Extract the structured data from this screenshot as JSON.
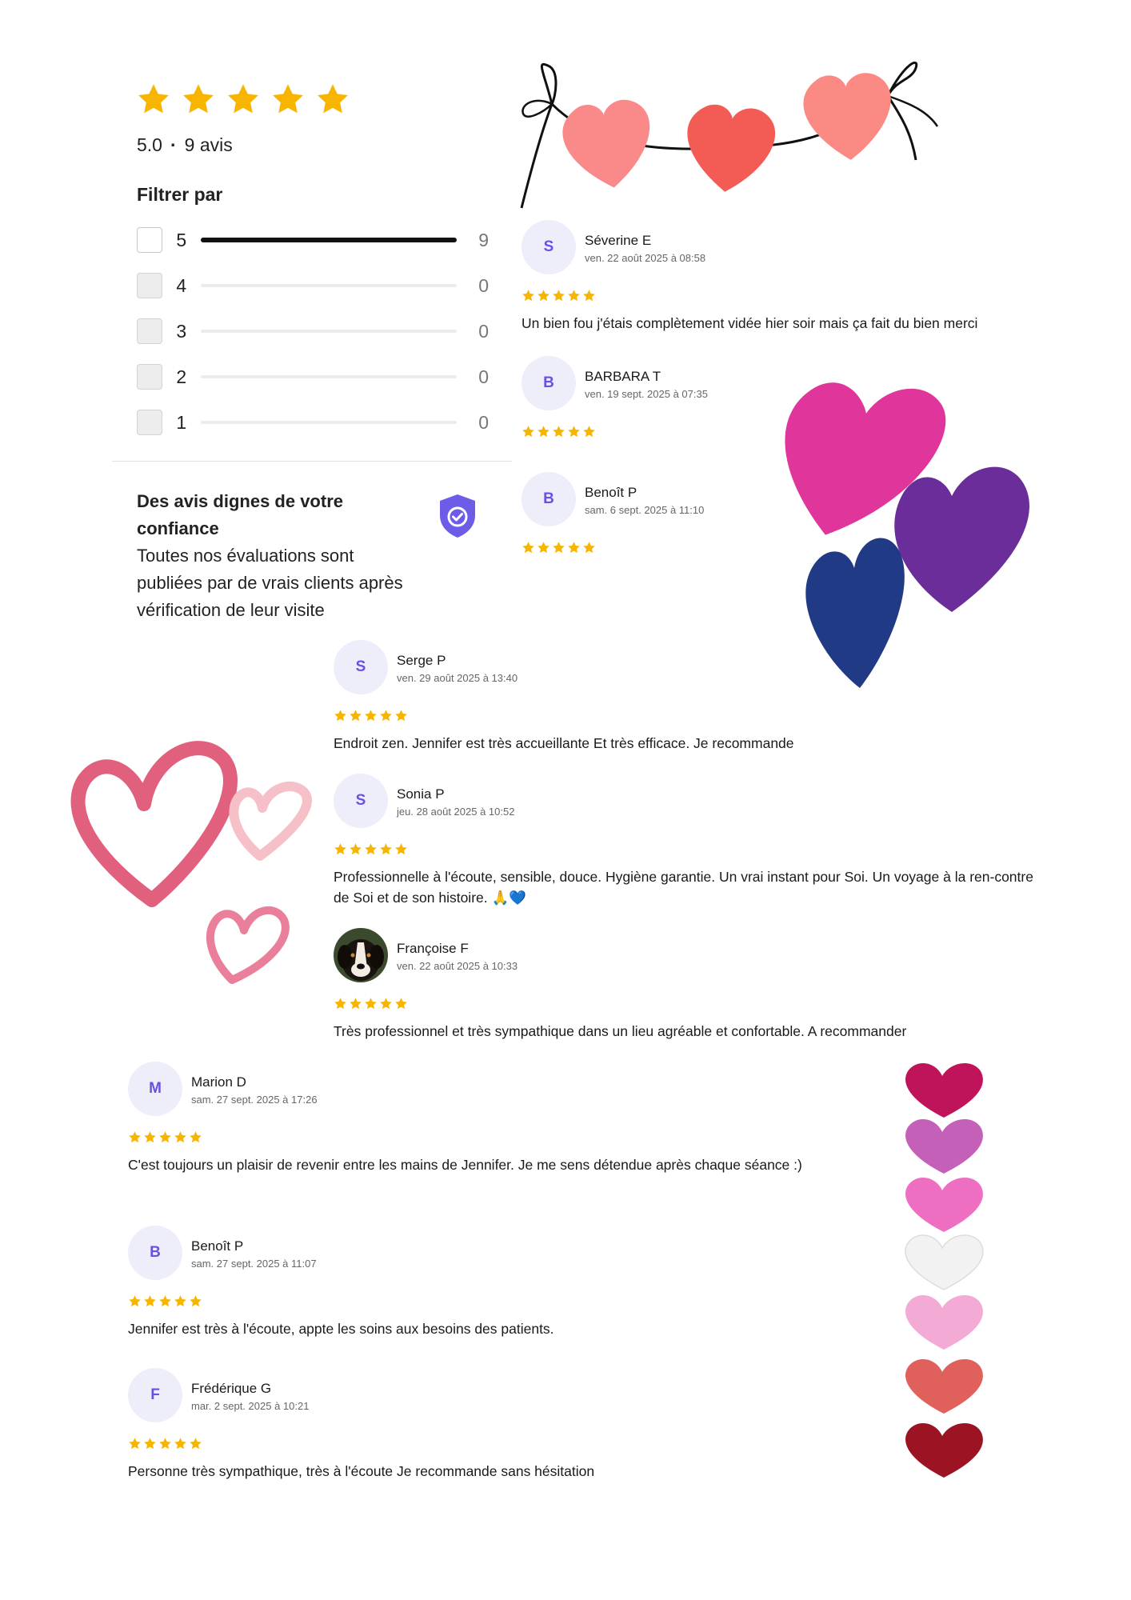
{
  "summary": {
    "stars": 5,
    "score": "5.0",
    "count_label": "9 avis",
    "filter_title": "Filtrer par",
    "filters": [
      {
        "label": "5",
        "count": "9",
        "fraction": 1.0,
        "checkbox_style": "white"
      },
      {
        "label": "4",
        "count": "0",
        "fraction": 0,
        "checkbox_style": "gray"
      },
      {
        "label": "3",
        "count": "0",
        "fraction": 0,
        "checkbox_style": "gray"
      },
      {
        "label": "2",
        "count": "0",
        "fraction": 0,
        "checkbox_style": "gray"
      },
      {
        "label": "1",
        "count": "0",
        "fraction": 0,
        "checkbox_style": "gray"
      }
    ]
  },
  "trust": {
    "title": "Des avis dignes de votre confiance",
    "text": "Toutes nos évaluations sont publiées par de vrais clients après vérification de leur visite",
    "icon": "shield-check-icon"
  },
  "reviews": [
    {
      "initial": "S",
      "name": "Séverine E",
      "date": "ven. 22 août 2025 à 08:58",
      "stars": 5,
      "text": "Un bien fou j'étais complètement vidée hier soir mais ça fait du bien merci"
    },
    {
      "initial": "B",
      "name": "BARBARA T",
      "date": "ven. 19 sept. 2025 à 07:35",
      "stars": 5,
      "text": ""
    },
    {
      "initial": "B",
      "name": "Benoît P",
      "date": "sam. 6 sept. 2025 à 11:10",
      "stars": 5,
      "text": ""
    },
    {
      "initial": "S",
      "name": "Serge P",
      "date": "ven. 29 août 2025 à 13:40",
      "stars": 5,
      "text": "Endroit zen. Jennifer est très accueillante Et très efficace. Je recommande"
    },
    {
      "initial": "S",
      "name": "Sonia P",
      "date": "jeu. 28 août 2025 à 10:52",
      "stars": 5,
      "text": "Professionnelle à l'écoute, sensible, douce. Hygiène garantie. Un vrai instant pour Soi. Un voyage à la ren-contre de Soi et de son histoire. 🙏💙"
    },
    {
      "initial": "",
      "avatar": "dog-photo-avatar",
      "name": "Françoise F",
      "date": "ven. 22 août 2025 à 10:33",
      "stars": 5,
      "text": "Très professionnel et très sympathique dans un lieu agréable et confortable. A recommander"
    },
    {
      "initial": "M",
      "name": "Marion D",
      "date": "sam. 27 sept. 2025 à 17:26",
      "stars": 5,
      "text": "C'est toujours un plaisir de revenir entre les mains de Jennifer. Je me sens détendue après chaque séance :)"
    },
    {
      "initial": "B",
      "name": "Benoît P",
      "date": "sam. 27 sept. 2025 à 11:07",
      "stars": 5,
      "text": "Jennifer est très à l'écoute, appte les soins aux besoins des patients."
    },
    {
      "initial": "F",
      "name": "Frédérique G",
      "date": "mar. 2 sept. 2025 à 10:21",
      "stars": 5,
      "text": "Personne très sympathique, très à l'écoute Je recommande sans hésitation"
    }
  ],
  "colors": {
    "star": "#f7b500",
    "avatar_bg": "#eeeefb",
    "avatar_text": "#6a4fe0",
    "shield": "#6c5ce7",
    "garland_hearts": [
      "#fa8a8a",
      "#f25c54",
      "#fb8a85"
    ],
    "big_hearts": [
      "#e0359a",
      "#6a2d9a",
      "#213a85"
    ],
    "outline_hearts": [
      "#e0607e",
      "#f6c0c9",
      "#ea7f9b"
    ],
    "heart_stack": [
      "#c0145a",
      "#c560b8",
      "#ee6fc2",
      "#f2f2f2",
      "#f3aad4",
      "#e0615b",
      "#9c1423"
    ]
  }
}
